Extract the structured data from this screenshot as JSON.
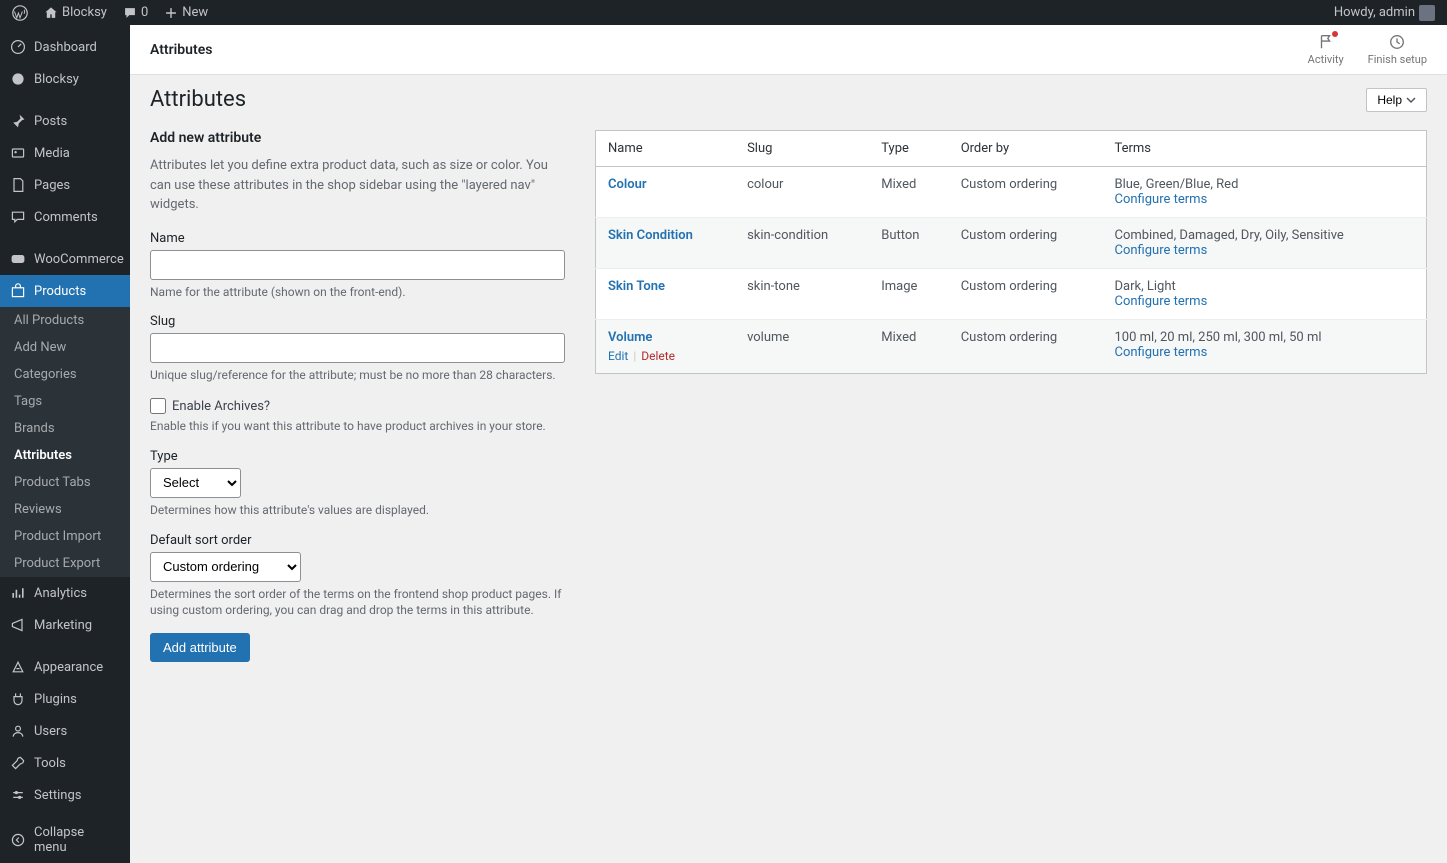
{
  "topbar": {
    "site_name": "Blocksy",
    "comments_count": "0",
    "new_label": "New",
    "howdy": "Howdy, admin"
  },
  "sidebar": {
    "items": [
      {
        "label": "Dashboard"
      },
      {
        "label": "Blocksy"
      },
      {
        "label": "Posts"
      },
      {
        "label": "Media"
      },
      {
        "label": "Pages"
      },
      {
        "label": "Comments"
      },
      {
        "label": "WooCommerce"
      },
      {
        "label": "Products"
      },
      {
        "label": "Analytics"
      },
      {
        "label": "Marketing"
      },
      {
        "label": "Appearance"
      },
      {
        "label": "Plugins"
      },
      {
        "label": "Users"
      },
      {
        "label": "Tools"
      },
      {
        "label": "Settings"
      },
      {
        "label": "Collapse menu"
      }
    ],
    "products_submenu": [
      {
        "label": "All Products"
      },
      {
        "label": "Add New"
      },
      {
        "label": "Categories"
      },
      {
        "label": "Tags"
      },
      {
        "label": "Brands"
      },
      {
        "label": "Attributes"
      },
      {
        "label": "Product Tabs"
      },
      {
        "label": "Reviews"
      },
      {
        "label": "Product Import"
      },
      {
        "label": "Product Export"
      }
    ]
  },
  "header": {
    "title": "Attributes",
    "activity": "Activity",
    "finish_setup": "Finish setup",
    "help": "Help"
  },
  "page": {
    "title": "Attributes",
    "form_heading": "Add new attribute",
    "intro": "Attributes let you define extra product data, such as size or color. You can use these attributes in the shop sidebar using the \"layered nav\" widgets.",
    "name_label": "Name",
    "name_help": "Name for the attribute (shown on the front-end).",
    "slug_label": "Slug",
    "slug_help": "Unique slug/reference for the attribute; must be no more than 28 characters.",
    "archives_label": "Enable Archives?",
    "archives_help": "Enable this if you want this attribute to have product archives in your store.",
    "type_label": "Type",
    "type_value": "Select",
    "type_help": "Determines how this attribute's values are displayed.",
    "sort_label": "Default sort order",
    "sort_value": "Custom ordering",
    "sort_help": "Determines the sort order of the terms on the frontend shop product pages. If using custom ordering, you can drag and drop the terms in this attribute.",
    "submit": "Add attribute"
  },
  "table": {
    "headers": {
      "name": "Name",
      "slug": "Slug",
      "type": "Type",
      "order_by": "Order by",
      "terms": "Terms"
    },
    "configure": "Configure terms",
    "edit": "Edit",
    "delete": "Delete",
    "rows": [
      {
        "name": "Colour",
        "slug": "colour",
        "type": "Mixed",
        "order_by": "Custom ordering",
        "terms": "Blue, Green/Blue, Red"
      },
      {
        "name": "Skin Condition",
        "slug": "skin-condition",
        "type": "Button",
        "order_by": "Custom ordering",
        "terms": "Combined, Damaged, Dry, Oily, Sensitive"
      },
      {
        "name": "Skin Tone",
        "slug": "skin-tone",
        "type": "Image",
        "order_by": "Custom ordering",
        "terms": "Dark, Light"
      },
      {
        "name": "Volume",
        "slug": "volume",
        "type": "Mixed",
        "order_by": "Custom ordering",
        "terms": "100 ml, 20 ml, 250 ml, 300 ml, 50 ml"
      }
    ]
  }
}
